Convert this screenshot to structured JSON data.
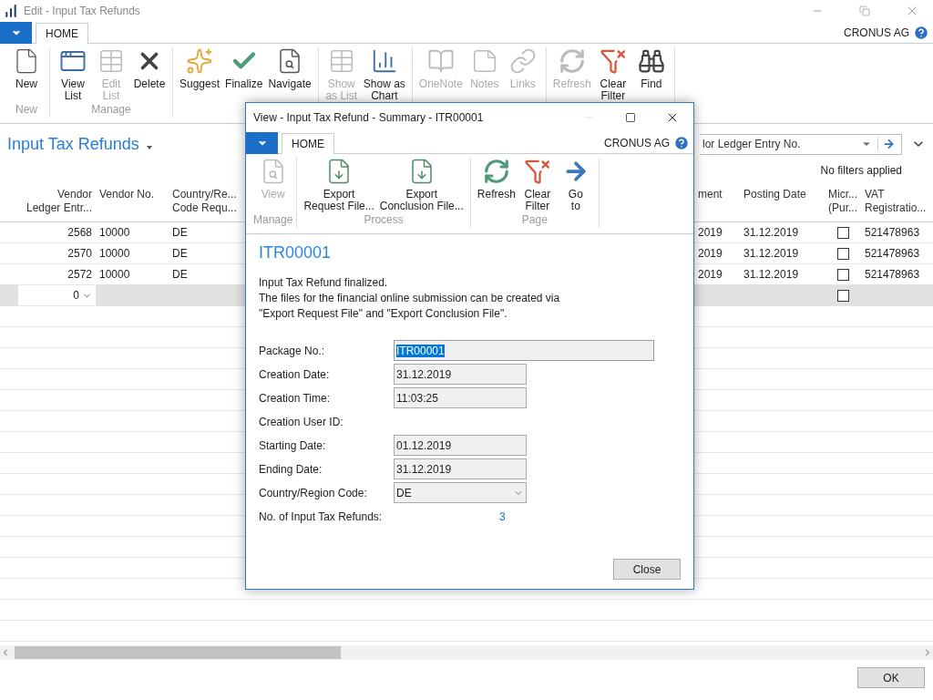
{
  "window": {
    "title": "Edit - Input Tax Refunds",
    "company": "CRONUS AG"
  },
  "tabs": [
    {
      "label": "HOME",
      "selected": true
    }
  ],
  "ribbon": [
    {
      "label": "New",
      "buttons": [
        {
          "label": "New",
          "disabled": false
        }
      ]
    },
    {
      "label": "Manage",
      "buttons": [
        {
          "label": "View\nList",
          "disabled": false
        },
        {
          "label": "Edit\nList",
          "disabled": true
        },
        {
          "label": "Delete",
          "disabled": false
        }
      ]
    },
    {
      "buttons": [
        {
          "label": "Suggest",
          "disabled": false
        },
        {
          "label": "Finalize",
          "disabled": false
        },
        {
          "label": "Navigate",
          "disabled": false
        }
      ]
    },
    {
      "buttons": [
        {
          "label": "Show\nas List",
          "disabled": true
        },
        {
          "label": "Show as\nChart",
          "disabled": false
        }
      ]
    },
    {
      "buttons": [
        {
          "label": "OneNote",
          "disabled": true
        },
        {
          "label": "Notes",
          "disabled": true
        },
        {
          "label": "Links",
          "disabled": true
        }
      ]
    },
    {
      "buttons": [
        {
          "label": "Refresh",
          "disabled": true
        },
        {
          "label": "Clear\nFilter",
          "disabled": false
        },
        {
          "label": "Find",
          "disabled": false
        }
      ]
    }
  ],
  "page": {
    "title": "Input Tax Refunds",
    "search": {
      "value": "lor Ledger Entry No."
    },
    "filter_status": "No filters applied"
  },
  "table": {
    "columns": [
      {
        "lines": [
          "Vendor",
          "Ledger Entr..."
        ]
      },
      {
        "lines": [
          "Vendor No."
        ]
      },
      {
        "lines": [
          "Country/Re...",
          "Code Requ..."
        ]
      },
      {
        "lines": [
          "ment"
        ]
      },
      {
        "lines": [
          "Posting Date"
        ]
      },
      {
        "lines": [
          "Micr...",
          "(Pur..."
        ]
      },
      {
        "lines": [
          "VAT",
          "Registratio..."
        ]
      }
    ],
    "rows": [
      {
        "cells": [
          "2568",
          "10000",
          "DE",
          "2019",
          "31.12.2019",
          "521478963"
        ],
        "checked": false,
        "selected": false
      },
      {
        "cells": [
          "2570",
          "10000",
          "DE",
          "2019",
          "31.12.2019",
          "521478963"
        ],
        "checked": false,
        "selected": false
      },
      {
        "cells": [
          "2572",
          "10000",
          "DE",
          "2019",
          "31.12.2019",
          "521478963"
        ],
        "checked": false,
        "selected": false
      },
      {
        "cells": [
          "0"
        ],
        "checked": false,
        "selected": true
      }
    ]
  },
  "ok_button": "OK",
  "dialog": {
    "title": "View - Input Tax Refund - Summary - ITR00001",
    "company": "CRONUS AG",
    "tabs": [
      {
        "label": "HOME",
        "selected": true
      }
    ],
    "ribbon": [
      {
        "label": "Manage",
        "buttons": [
          {
            "label": "View",
            "disabled": true
          }
        ]
      },
      {
        "label": "Process",
        "buttons": [
          {
            "label": "Export\nRequest File...",
            "disabled": false
          },
          {
            "label": "Export\nConclusion File...",
            "disabled": false
          }
        ]
      },
      {
        "label": "Page",
        "buttons": [
          {
            "label": "Refresh",
            "disabled": false
          },
          {
            "label": "Clear\nFilter",
            "disabled": false
          },
          {
            "label": "Go\nto",
            "disabled": false
          }
        ]
      }
    ],
    "heading": "ITR00001",
    "message": [
      "Input Tax Refund finalized.",
      "The files for the financial online submission can be created via",
      "\"Export Request File\" and \"Export Conclusion File\"."
    ],
    "fields": [
      {
        "label": "Package No.:",
        "value": "ITR00001",
        "kind": "wide",
        "selected": true
      },
      {
        "label": "Creation Date:",
        "value": "31.12.2019",
        "kind": "text",
        "selected": false
      },
      {
        "label": "Creation Time:",
        "value": "11:03:25",
        "kind": "text",
        "selected": false
      },
      {
        "label": "Creation User ID:",
        "kind": "empty"
      },
      {
        "label": "Starting Date:",
        "value": "01.12.2019",
        "kind": "text",
        "selected": false
      },
      {
        "label": "Ending Date:",
        "value": "31.12.2019",
        "kind": "text",
        "selected": false
      },
      {
        "label": "Country/Region Code:",
        "value": "DE",
        "kind": "select",
        "selected": false
      },
      {
        "label": "No. of Input Tax Refunds:",
        "value": "3",
        "kind": "link"
      }
    ],
    "close_button": "Close"
  }
}
